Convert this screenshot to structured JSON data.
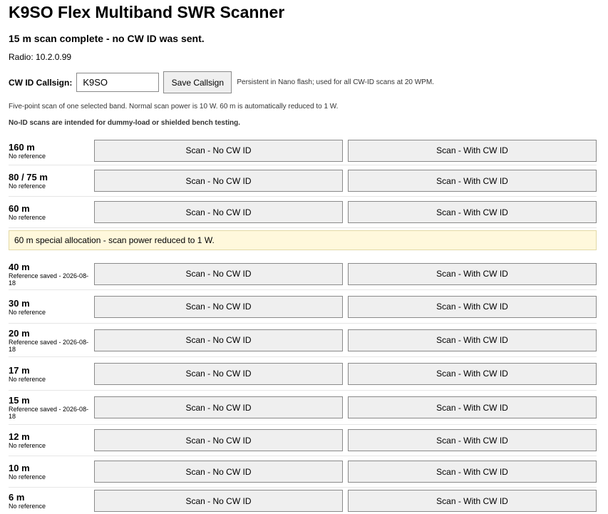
{
  "title": "K9SO Flex Multiband SWR Scanner",
  "status": "15 m scan complete - no CW ID was sent.",
  "radio": "Radio: 10.2.0.99",
  "cwid": {
    "label": "CW ID Callsign:",
    "value": "K9SO",
    "save_label": "Save Callsign",
    "note": "Persistent in Nano flash; used for all CW-ID scans at 20 WPM."
  },
  "description": "Five-point scan of one selected band. Normal scan power is 10 W. 60 m is automatically reduced to 1 W.",
  "warning": "No-ID scans are intended for dummy-load or shielded bench testing.",
  "scan_labels": {
    "no_id": "Scan - No CW ID",
    "with_id": "Scan - With CW ID"
  },
  "alloc_note": "60 m special allocation - scan power reduced to 1 W.",
  "bands": [
    {
      "name": "160 m",
      "ref": "No reference"
    },
    {
      "name": "80 / 75 m",
      "ref": "No reference"
    },
    {
      "name": "60 m",
      "ref": "No reference"
    },
    {
      "name": "40 m",
      "ref": "Reference saved - 2026-08-18"
    },
    {
      "name": "30 m",
      "ref": "No reference"
    },
    {
      "name": "20 m",
      "ref": "Reference saved - 2026-08-18"
    },
    {
      "name": "17 m",
      "ref": "No reference"
    },
    {
      "name": "15 m",
      "ref": "Reference saved - 2026-08-18"
    },
    {
      "name": "12 m",
      "ref": "No reference"
    },
    {
      "name": "10 m",
      "ref": "No reference"
    },
    {
      "name": "6 m",
      "ref": "No reference"
    }
  ]
}
